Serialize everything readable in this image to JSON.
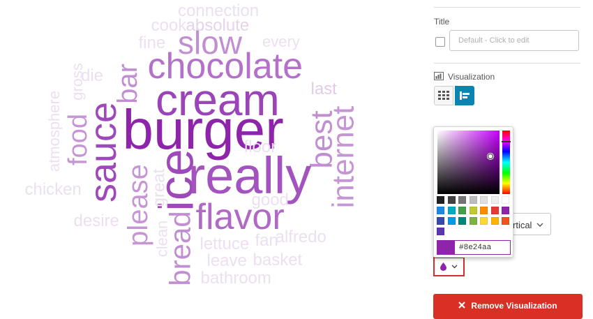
{
  "cloud": {
    "words": [
      {
        "text": "connection",
        "color": "#ecdff0"
      },
      {
        "text": "cook",
        "color": "#ecdff0"
      },
      {
        "text": "absolute",
        "color": "#e5d3ec"
      },
      {
        "text": "fine",
        "color": "#ecdff0"
      },
      {
        "text": "every",
        "color": "#ecdff0"
      },
      {
        "text": "slow",
        "color": "#c28ed2"
      },
      {
        "text": "bar",
        "color": "#c28ed2"
      },
      {
        "text": "chocolate",
        "color": "#b571c9"
      },
      {
        "text": "die",
        "color": "#ecdff0"
      },
      {
        "text": "gross",
        "color": "#ecdff0"
      },
      {
        "text": "last",
        "color": "#e1cbe9"
      },
      {
        "text": "cream",
        "color": "#9b43b8"
      },
      {
        "text": "atmosphere",
        "color": "#ecdff0"
      },
      {
        "text": "food",
        "color": "#c696d4"
      },
      {
        "text": "sauce",
        "color": "#9e49ba"
      },
      {
        "text": "burger",
        "color": "#8e24aa"
      },
      {
        "text": "best",
        "color": "#c28ed2"
      },
      {
        "text": "internet",
        "color": "#c696d4"
      },
      {
        "text": "floor",
        "color": "#ecdff0"
      },
      {
        "text": "ice",
        "color": "#9e49ba"
      },
      {
        "text": "really",
        "color": "#a353bd"
      },
      {
        "text": "chicken",
        "color": "#ecdff0"
      },
      {
        "text": "great",
        "color": "#ecdff0"
      },
      {
        "text": "please",
        "color": "#c696d4"
      },
      {
        "text": "good",
        "color": "#ecdff0"
      },
      {
        "text": "flavor",
        "color": "#b06ac6"
      },
      {
        "text": "desire",
        "color": "#ecdff0"
      },
      {
        "text": "alfredo",
        "color": "#ecdff0"
      },
      {
        "text": "clean",
        "color": "#ecdff0"
      },
      {
        "text": "bread",
        "color": "#c28ed2"
      },
      {
        "text": "lettuce",
        "color": "#ecdff0"
      },
      {
        "text": "fan",
        "color": "#ecdff0"
      },
      {
        "text": "leave",
        "color": "#ecdff0"
      },
      {
        "text": "basket",
        "color": "#ecdff0"
      },
      {
        "text": "bathroom",
        "color": "#ecdff0"
      }
    ]
  },
  "panel": {
    "title_label": "Title",
    "title_placeholder": "Default - Click to edit",
    "visualization_label": "Visualization",
    "orientation_value": "rtical",
    "remove_button": "Remove Visualization"
  },
  "color_picker": {
    "hex_value": "#8e24aa",
    "selected_color": "#8e24aa",
    "swatches": [
      "#212121",
      "#424242",
      "#757575",
      "#bdbdbd",
      "#e0e0e0",
      "#eeeeee",
      "#ffffff",
      "#1e88e5",
      "#00acc1",
      "#43a047",
      "#c0ca33",
      "#fb8c00",
      "#e53935",
      "#8e24aa",
      "#3949ab",
      "#039be5",
      "#00897b",
      "#7cb342",
      "#fdd835",
      "#ffb300",
      "#f4511e",
      "#5e35b1"
    ]
  },
  "accent_color": "#0a84b0",
  "icons": [
    "visualization-icon",
    "table-grid-icon",
    "word-cloud-icon",
    "chevron-down-icon",
    "droplet-icon",
    "close-x-icon"
  ]
}
